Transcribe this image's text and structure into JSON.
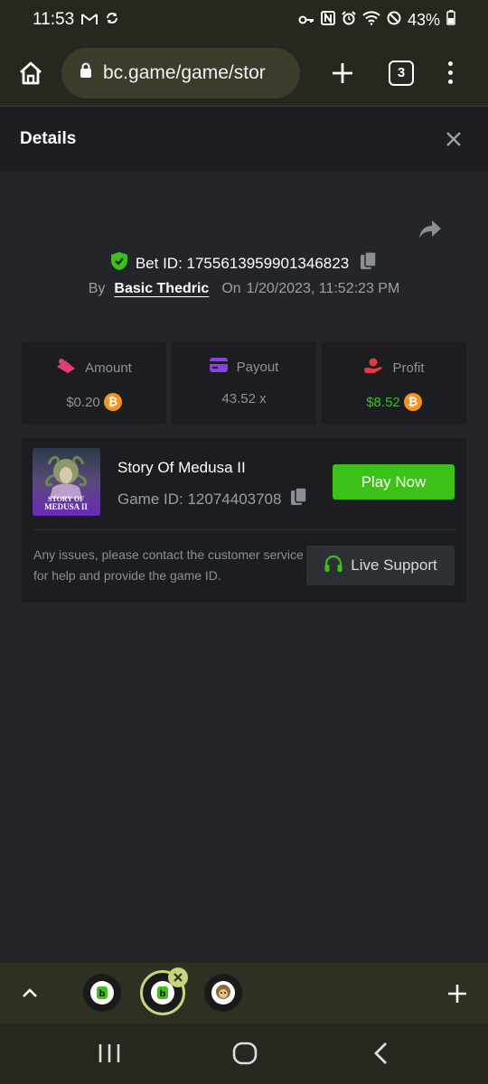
{
  "status_bar": {
    "time": "11:53",
    "battery": "43%",
    "left_icons": [
      "gmail-icon",
      "sync-icon"
    ],
    "right_icons": [
      "key-icon",
      "nfc-icon",
      "alarm-icon",
      "wifi-icon",
      "dnd-icon",
      "battery-icon"
    ]
  },
  "browser": {
    "url": "bc.game/game/stor",
    "tab_count": "3"
  },
  "details": {
    "title": "Details"
  },
  "bet": {
    "label": "Bet ID: 1755613959901346823",
    "by_label": "By",
    "user": "Basic Thedric",
    "on_label": "On",
    "datetime": "1/20/2023, 11:52:23 PM"
  },
  "stats": {
    "amount_label": "Amount",
    "amount_value": "$0.20",
    "payout_label": "Payout",
    "payout_value": "43.52 x",
    "profit_label": "Profit",
    "profit_value": "$8.52",
    "coin_symbol": "₿"
  },
  "game": {
    "name": "Story Of Medusa II",
    "id_text": "Game ID: 12074403708",
    "thumb_line1": "STORY OF",
    "thumb_line2": "MEDUSA II",
    "play_label": "Play Now",
    "issue_text": "Any issues, please contact the customer service for help and provide the game ID.",
    "support_label": "Live Support"
  },
  "colors": {
    "accent_green": "#3bc117",
    "background": "#232529",
    "card": "#1b1d21"
  }
}
